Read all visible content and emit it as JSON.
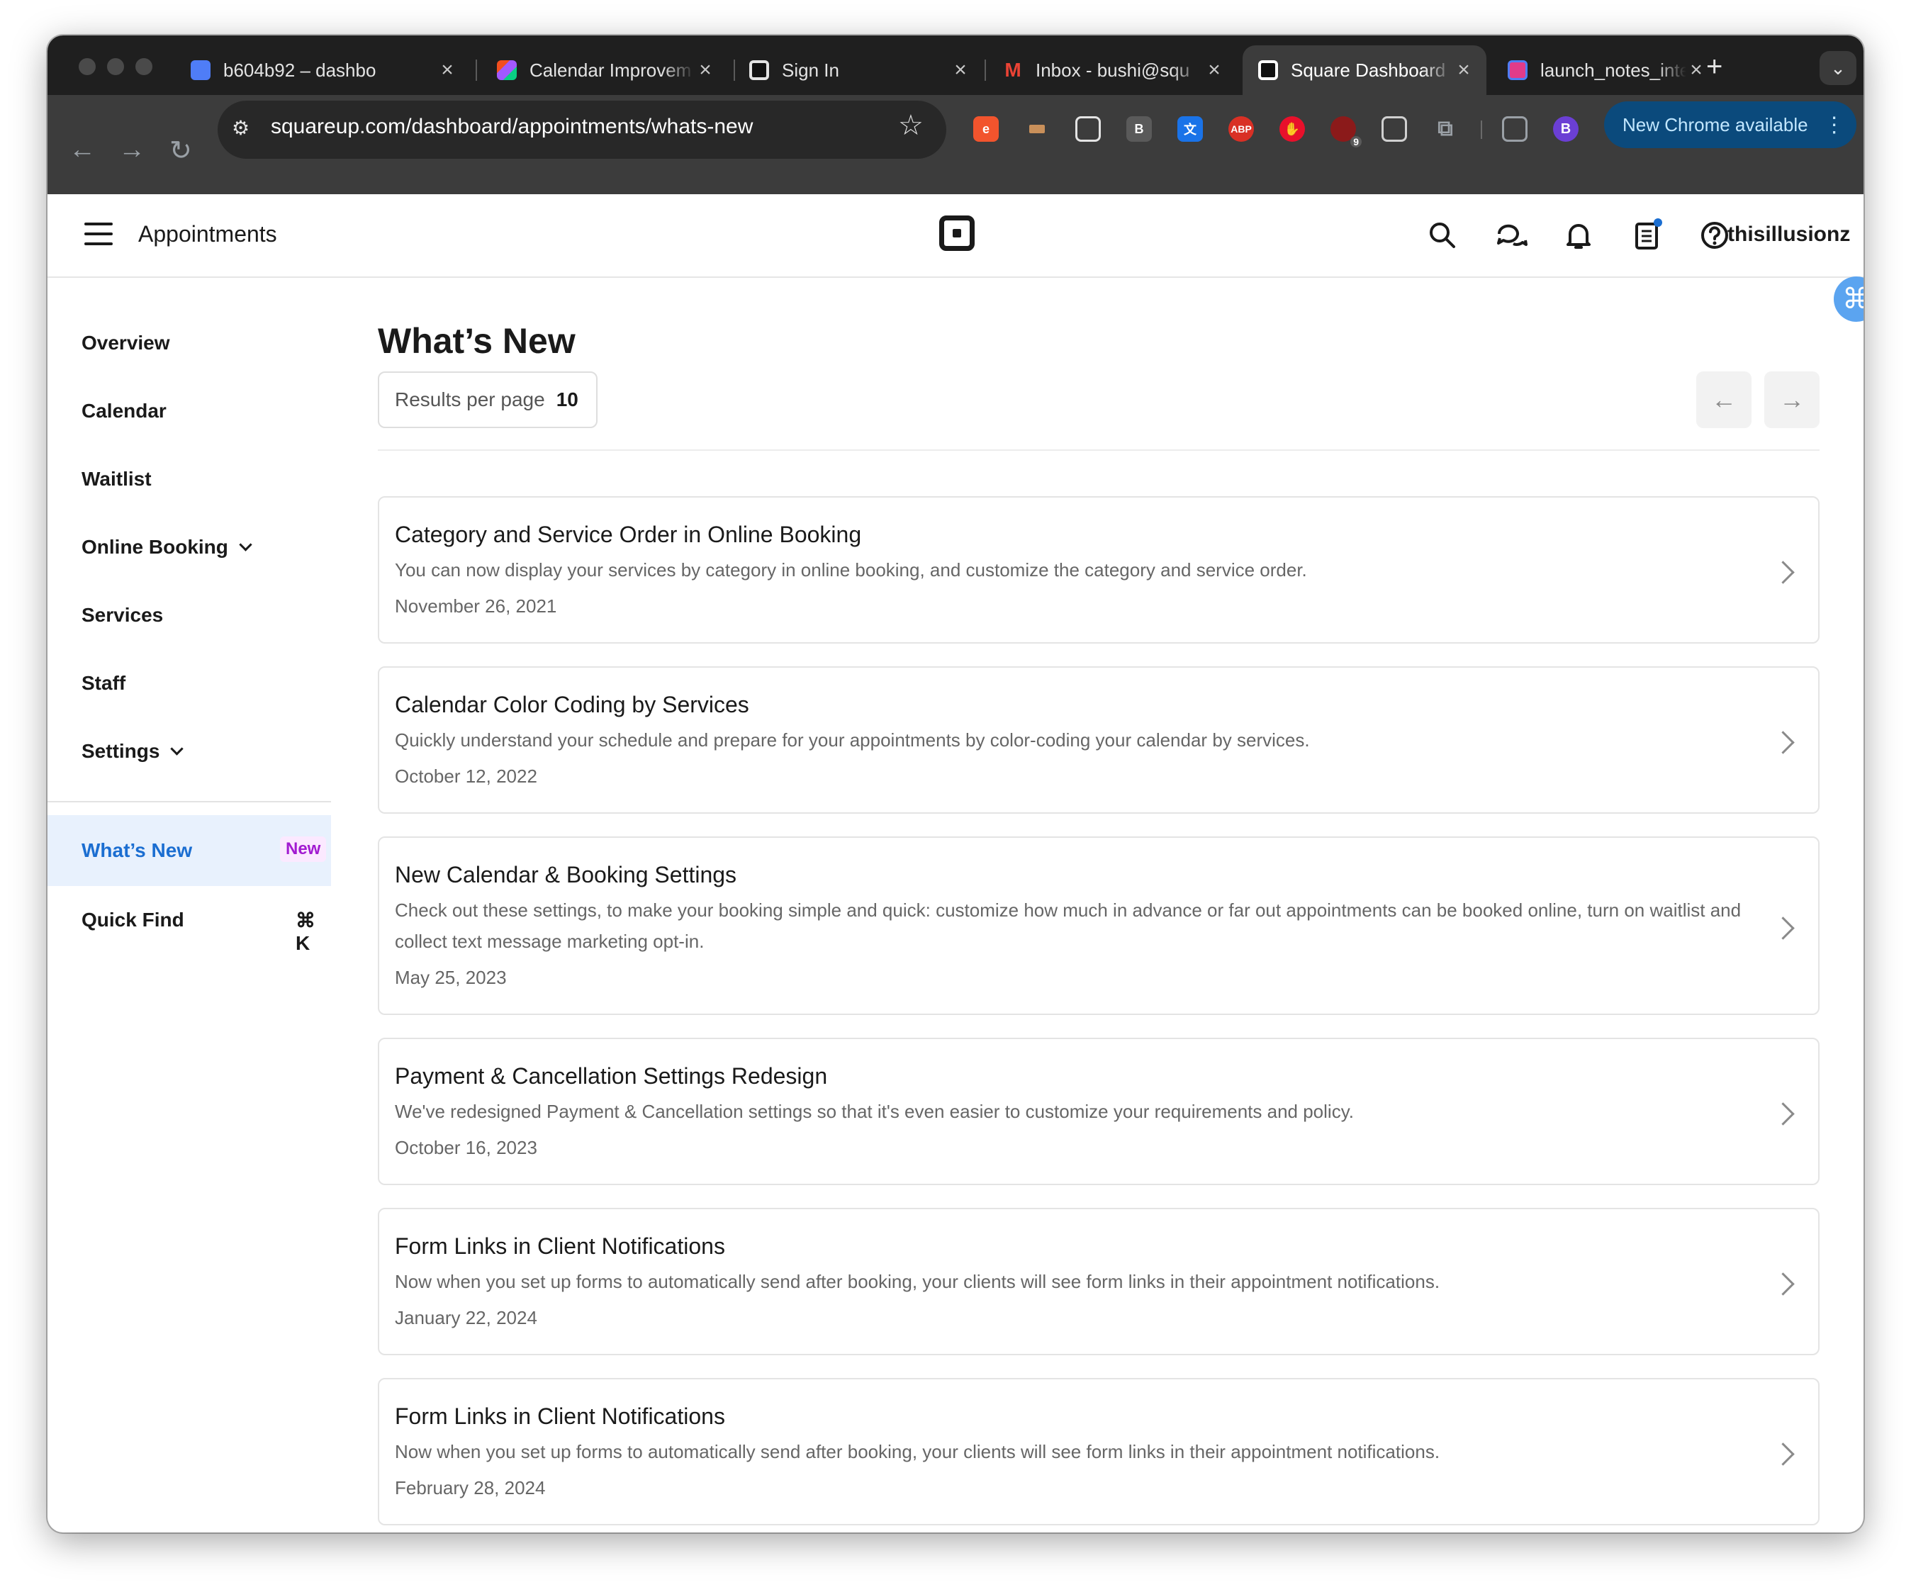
{
  "browser": {
    "tabs": [
      {
        "title": "b604b92 – dashbo",
        "fav_color": "#4f7df7",
        "fav_glyph": ""
      },
      {
        "title": "Calendar Improvem",
        "fav_color": "#f24e1e",
        "fav_glyph": ""
      },
      {
        "title": "Sign In",
        "fav_color": "#111111",
        "fav_glyph": ""
      },
      {
        "title": "Inbox - bushi@squ",
        "fav_color": "#ea4335",
        "fav_glyph": "M"
      },
      {
        "title": "Square Dashboard",
        "fav_color": "#111111",
        "fav_glyph": "",
        "active": true
      },
      {
        "title": "launch_notes_inte",
        "fav_color": "#e23b8a",
        "fav_glyph": ""
      }
    ],
    "url": "squareup.com/dashboard/appointments/whats-new",
    "new_chrome_label": "New Chrome available",
    "profile_initial": "B",
    "ext_badge_count": "9"
  },
  "header": {
    "app_title": "Appointments",
    "username": "thisillusionz"
  },
  "sidebar": {
    "items": [
      {
        "label": "Overview"
      },
      {
        "label": "Calendar"
      },
      {
        "label": "Waitlist"
      },
      {
        "label": "Online Booking"
      },
      {
        "label": "Services"
      },
      {
        "label": "Staff"
      },
      {
        "label": "Settings"
      }
    ],
    "whats_new": {
      "label": "What’s New",
      "badge": "New"
    },
    "quick_find": {
      "label": "Quick Find",
      "shortcut": "⌘ K"
    }
  },
  "main": {
    "title": "What’s New",
    "results_per_page_label": "Results per page",
    "results_per_page_value": "10",
    "cards": [
      {
        "title": "Category and Service Order in Online Booking",
        "desc": "You can now display your services by category in online booking, and customize the category and service order.",
        "date": "November 26, 2021"
      },
      {
        "title": "Calendar Color Coding by Services",
        "desc": "Quickly understand your schedule and prepare for your appointments by color-coding your calendar by services.",
        "date": "October 12, 2022"
      },
      {
        "title": "New Calendar & Booking Settings",
        "desc": "Check out these settings, to make your booking simple and quick: customize how much in advance or far out appointments can be booked online, turn on waitlist and collect text message marketing opt-in.",
        "date": "May 25, 2023"
      },
      {
        "title": "Payment & Cancellation Settings Redesign",
        "desc": "We've redesigned Payment & Cancellation settings so that it's even easier to customize your requirements and policy.",
        "date": "October 16, 2023"
      },
      {
        "title": "Form Links in Client Notifications",
        "desc": "Now when you set up forms to automatically send after booking, your clients will see form links in their appointment notifications.",
        "date": "January 22, 2024"
      },
      {
        "title": "Form Links in Client Notifications",
        "desc": "Now when you set up forms to automatically send after booking, your clients will see form links in their appointment notifications.",
        "date": "February 28, 2024"
      }
    ]
  },
  "colors": {
    "accent": "#1b6ed1",
    "badge_text": "#a21bd1",
    "badge_bg": "#fbe9ff",
    "active_row_bg": "#e8f1fd"
  }
}
